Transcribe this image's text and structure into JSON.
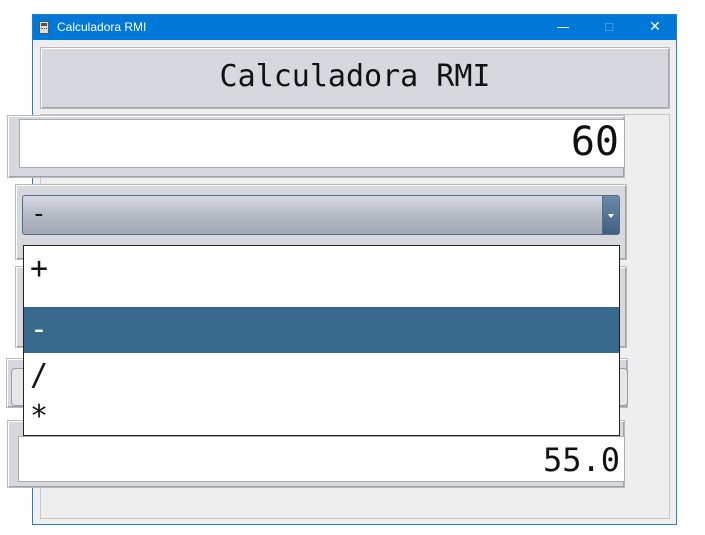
{
  "window": {
    "title": "Calculadora RMI",
    "controls": {
      "minimize": "—",
      "maximize": "☐",
      "close": "✕"
    }
  },
  "header": {
    "title": "Calculadora RMI"
  },
  "operand_field": {
    "value": "60"
  },
  "operator_select": {
    "selected": "-",
    "options": [
      "+",
      "-",
      "/",
      "*"
    ],
    "highlighted_index": 1,
    "open": true
  },
  "result_field": {
    "value": "55.0"
  },
  "colors": {
    "titlebar": "#0078d7",
    "panel": "#d6d8dd",
    "selection": "#36698b"
  }
}
